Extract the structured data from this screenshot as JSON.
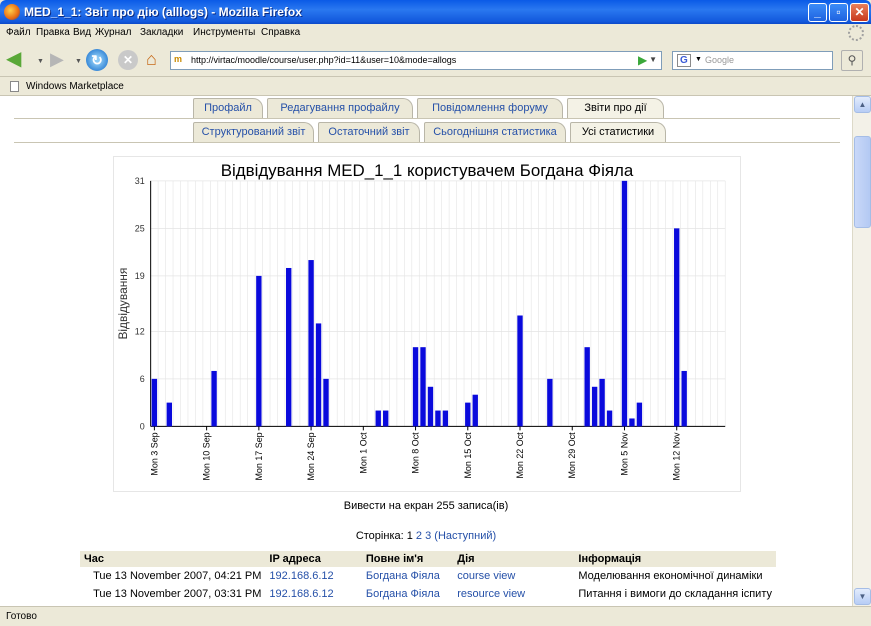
{
  "window": {
    "title": "MED_1_1: Звіт про дію (alllogs) - Mozilla Firefox",
    "min_glyph": "_",
    "max_glyph": "▫",
    "close_glyph": "✕"
  },
  "menu": [
    "Файл",
    "Правка",
    "Вид",
    "Журнал",
    "Закладки",
    "Инструменты",
    "Справка"
  ],
  "toolbar": {
    "url": "http://virtac/moodle/course/user.php?id=11&user=10&mode=allogs",
    "search_placeholder": "Google",
    "search_engine_letter": "G"
  },
  "bookmarks": [
    "Windows Marketplace"
  ],
  "tabs_row1": [
    {
      "label": "Профайл",
      "active": false
    },
    {
      "label": "Редагування профайлу",
      "active": false
    },
    {
      "label": "Повідомлення форуму",
      "active": false
    },
    {
      "label": "Звіти про дії",
      "active": true
    }
  ],
  "tabs_row2": [
    {
      "label": "Структурований звіт",
      "active": false
    },
    {
      "label": "Остаточний звіт",
      "active": false
    },
    {
      "label": "Сьогоднішня статистика",
      "active": false
    },
    {
      "label": "Усі статистики",
      "active": true
    }
  ],
  "chart_data": {
    "type": "bar",
    "title": "Відвідування  MED_1_1 користувачем Богдана Фіяла",
    "ylabel": "Відвідування",
    "xlabel": "",
    "ylim": [
      0,
      31
    ],
    "yticks": [
      0,
      6,
      12,
      19,
      25,
      31
    ],
    "grid": true,
    "bar_color": "#0a0adc",
    "start_date": "Mon 3 Sep",
    "days": 77,
    "xticks": [
      {
        "day": 0,
        "label": "Mon 3 Sep"
      },
      {
        "day": 7,
        "label": "Mon 10 Sep"
      },
      {
        "day": 14,
        "label": "Mon 17 Sep"
      },
      {
        "day": 21,
        "label": "Mon 24 Sep"
      },
      {
        "day": 28,
        "label": "Mon 1 Oct"
      },
      {
        "day": 35,
        "label": "Mon 8 Oct"
      },
      {
        "day": 42,
        "label": "Mon 15 Oct"
      },
      {
        "day": 49,
        "label": "Mon 22 Oct"
      },
      {
        "day": 56,
        "label": "Mon 29 Oct"
      },
      {
        "day": 63,
        "label": "Mon 5 Nov"
      },
      {
        "day": 70,
        "label": "Mon 12 Nov"
      }
    ],
    "points": [
      {
        "day": 0,
        "value": 6
      },
      {
        "day": 2,
        "value": 3
      },
      {
        "day": 8,
        "value": 7
      },
      {
        "day": 14,
        "value": 19
      },
      {
        "day": 18,
        "value": 20
      },
      {
        "day": 21,
        "value": 21
      },
      {
        "day": 22,
        "value": 13
      },
      {
        "day": 23,
        "value": 6
      },
      {
        "day": 30,
        "value": 2
      },
      {
        "day": 31,
        "value": 2
      },
      {
        "day": 35,
        "value": 10
      },
      {
        "day": 36,
        "value": 10
      },
      {
        "day": 37,
        "value": 5
      },
      {
        "day": 38,
        "value": 2
      },
      {
        "day": 39,
        "value": 2
      },
      {
        "day": 42,
        "value": 3
      },
      {
        "day": 43,
        "value": 4
      },
      {
        "day": 49,
        "value": 14
      },
      {
        "day": 53,
        "value": 6
      },
      {
        "day": 58,
        "value": 10
      },
      {
        "day": 59,
        "value": 5
      },
      {
        "day": 60,
        "value": 6
      },
      {
        "day": 61,
        "value": 2
      },
      {
        "day": 63,
        "value": 31
      },
      {
        "day": 64,
        "value": 1
      },
      {
        "day": 65,
        "value": 3
      },
      {
        "day": 70,
        "value": 25
      },
      {
        "day": 71,
        "value": 7
      }
    ]
  },
  "records_text": "Вивести на екран 255 записа(ів)",
  "pager": {
    "label": "Сторінка:",
    "current": "1",
    "pages": [
      "2",
      "3"
    ],
    "next": "(Наступний)"
  },
  "table": {
    "headers": [
      "Час",
      "IP адреса",
      "Повне ім'я",
      "Дія",
      "Інформація"
    ],
    "rows": [
      [
        "Tue 13 November 2007, 04:21 PM",
        "192.168.6.12",
        "Богдана Фіяла",
        "course view",
        "Моделювання економічної динаміки"
      ],
      [
        "Tue 13 November 2007, 03:31 PM",
        "192.168.6.12",
        "Богдана Фіяла",
        "resource view",
        "Питання і вимоги до складання іспиту"
      ]
    ]
  },
  "status": "Готово"
}
